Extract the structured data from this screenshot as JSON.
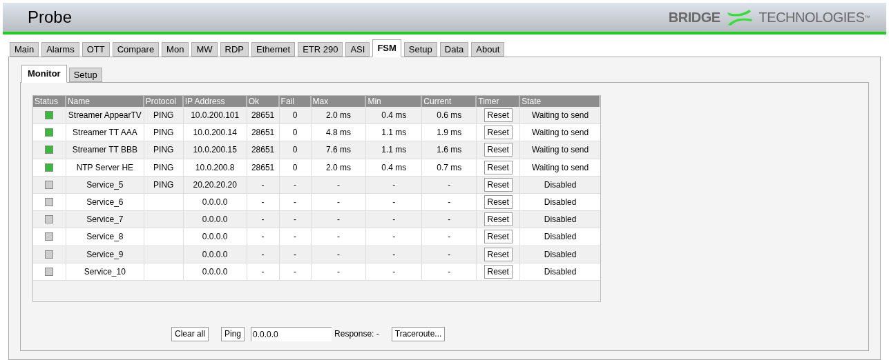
{
  "header": {
    "title": "Probe",
    "logo_left": "BRIDGE",
    "logo_right": "TECHNOLOGIES",
    "logo_mark": "™"
  },
  "tabs": [
    {
      "label": "Main",
      "selected": false
    },
    {
      "label": "Alarms",
      "selected": false
    },
    {
      "label": "OTT",
      "selected": false
    },
    {
      "label": "Compare",
      "selected": false
    },
    {
      "label": "Mon",
      "selected": false
    },
    {
      "label": "MW",
      "selected": false
    },
    {
      "label": "RDP",
      "selected": false
    },
    {
      "label": "Ethernet",
      "selected": false
    },
    {
      "label": "ETR 290",
      "selected": false
    },
    {
      "label": "ASI",
      "selected": false
    },
    {
      "label": "FSM",
      "selected": true
    },
    {
      "label": "Setup",
      "selected": false
    },
    {
      "label": "Data",
      "selected": false
    },
    {
      "label": "About",
      "selected": false
    }
  ],
  "subtabs": [
    {
      "label": "Monitor",
      "selected": true
    },
    {
      "label": "Setup",
      "selected": false
    }
  ],
  "table": {
    "columns": [
      "Status",
      "Name",
      "Protocol",
      "IP Address",
      "Ok",
      "Fail",
      "Max",
      "Min",
      "Current",
      "Timer",
      "State"
    ],
    "rows": [
      {
        "color": "#3cb83c",
        "name": "Streamer AppearTV",
        "protocol": "PING",
        "ip": "10.0.200.101",
        "ok": "28651",
        "fail": "0",
        "max": "2.0 ms",
        "min": "0.4 ms",
        "current": "0.6 ms",
        "timer": "Reset",
        "state": "Waiting to send"
      },
      {
        "color": "#3cb83c",
        "name": "Streamer TT AAA",
        "protocol": "PING",
        "ip": "10.0.200.14",
        "ok": "28651",
        "fail": "0",
        "max": "4.8 ms",
        "min": "1.1 ms",
        "current": "1.9 ms",
        "timer": "Reset",
        "state": "Waiting to send"
      },
      {
        "color": "#3cb83c",
        "name": "Streamer TT BBB",
        "protocol": "PING",
        "ip": "10.0.200.15",
        "ok": "28651",
        "fail": "0",
        "max": "7.6 ms",
        "min": "1.1 ms",
        "current": "1.6 ms",
        "timer": "Reset",
        "state": "Waiting to send"
      },
      {
        "color": "#3cb83c",
        "name": "NTP Server HE",
        "protocol": "PING",
        "ip": "10.0.200.8",
        "ok": "28651",
        "fail": "0",
        "max": "2.0 ms",
        "min": "0.4 ms",
        "current": "0.7 ms",
        "timer": "Reset",
        "state": "Waiting to send"
      },
      {
        "color": "#cccccc",
        "name": "Service_5",
        "protocol": "PING",
        "ip": "20.20.20.20",
        "ok": "-",
        "fail": "-",
        "max": "-",
        "min": "-",
        "current": "-",
        "timer": "Reset",
        "state": "Disabled"
      },
      {
        "color": "#cccccc",
        "name": "Service_6",
        "ip": "0.0.0.0",
        "ok": "-",
        "fail": "-",
        "max": "-",
        "min": "-",
        "current": "-",
        "timer": "Reset",
        "state": "Disabled"
      },
      {
        "color": "#cccccc",
        "name": "Service_7",
        "ip": "0.0.0.0",
        "ok": "-",
        "fail": "-",
        "max": "-",
        "min": "-",
        "current": "-",
        "timer": "Reset",
        "state": "Disabled"
      },
      {
        "color": "#cccccc",
        "name": "Service_8",
        "ip": "0.0.0.0",
        "ok": "-",
        "fail": "-",
        "max": "-",
        "min": "-",
        "current": "-",
        "timer": "Reset",
        "state": "Disabled"
      },
      {
        "color": "#cccccc",
        "name": "Service_9",
        "ip": "0.0.0.0",
        "ok": "-",
        "fail": "-",
        "max": "-",
        "min": "-",
        "current": "-",
        "timer": "Reset",
        "state": "Disabled"
      },
      {
        "color": "#cccccc",
        "name": "Service_10",
        "ip": "0.0.0.0",
        "ok": "-",
        "fail": "-",
        "max": "-",
        "min": "-",
        "current": "-",
        "timer": "Reset",
        "state": "Disabled"
      }
    ]
  },
  "controls": {
    "clear_button": "Clear all",
    "ping_button": "Ping",
    "address_value": "0.0.0.0",
    "response": "Response: -",
    "traceroute_button": "Traceroute..."
  }
}
